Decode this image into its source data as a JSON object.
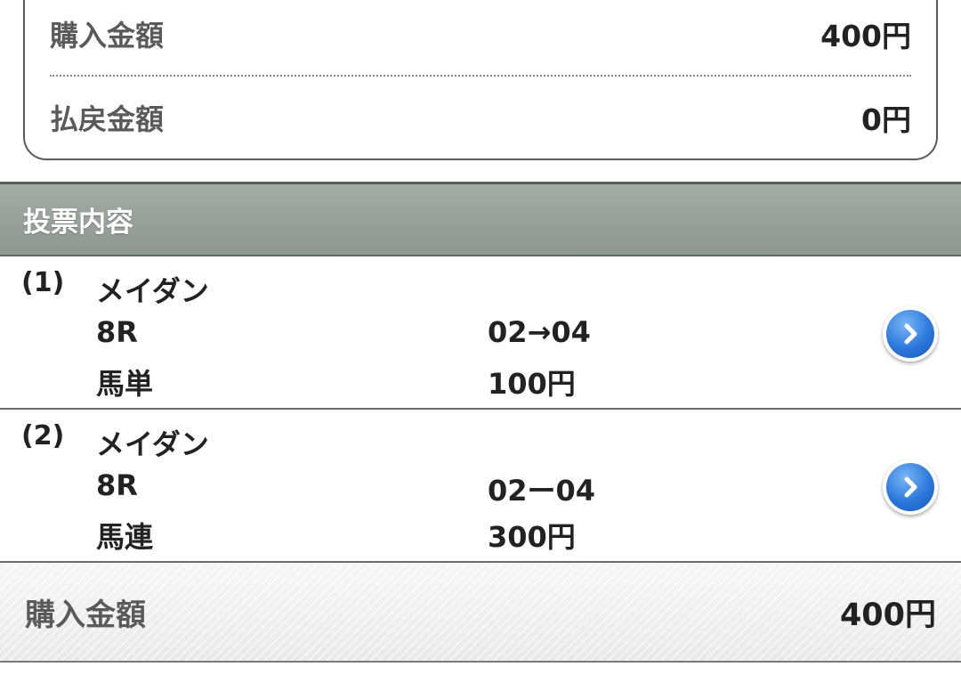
{
  "summary": {
    "purchase_label": "購入金額",
    "purchase_value": "400円",
    "refund_label": "払戻金額",
    "refund_value": "0円"
  },
  "section": {
    "title": "投票内容"
  },
  "bets": [
    {
      "index": "(1)",
      "venue": "メイダン",
      "race": "8R",
      "bet_type": "馬単",
      "selection": "02→04",
      "amount": "100円"
    },
    {
      "index": "(2)",
      "venue": "メイダン",
      "race": "8R",
      "bet_type": "馬連",
      "selection": "02ー04",
      "amount": "300円"
    }
  ],
  "footer": {
    "total_label": "購入金額",
    "total_value": "400円"
  },
  "icons": {
    "detail": "chevron-right-circle-icon"
  },
  "colors": {
    "header_bg": "#95a097",
    "button_blue": "#2b78dc"
  }
}
